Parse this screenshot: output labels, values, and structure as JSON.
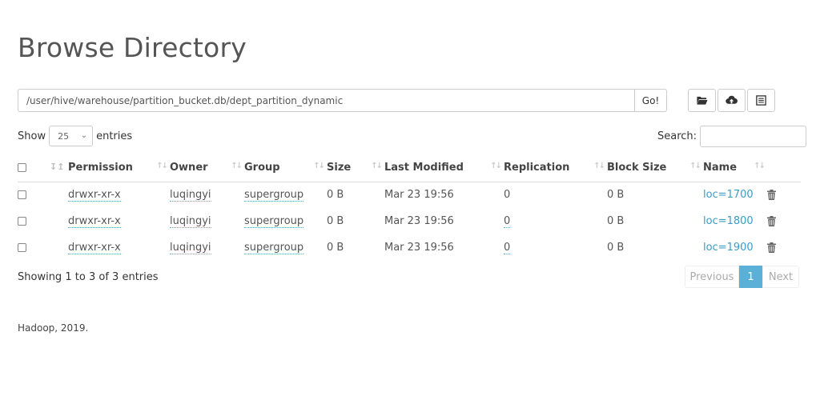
{
  "page": {
    "title": "Browse Directory"
  },
  "path_bar": {
    "value": "/user/hive/warehouse/partition_bucket.db/dept_partition_dynamic",
    "go_label": "Go!"
  },
  "toolbar": {
    "icons": [
      "folder-open-icon",
      "upload-icon",
      "list-icon"
    ]
  },
  "show": {
    "prefix": "Show",
    "selected": "25",
    "suffix": "entries"
  },
  "search": {
    "label": "Search:",
    "value": ""
  },
  "table": {
    "columns": [
      "Permission",
      "Owner",
      "Group",
      "Size",
      "Last Modified",
      "Replication",
      "Block Size",
      "Name"
    ],
    "rows": [
      {
        "permission": "drwxr-xr-x",
        "owner": "luqingyi",
        "group": "supergroup",
        "size": "0 B",
        "modified": "Mar 23 19:56",
        "replication": "0",
        "block_size": "0 B",
        "name": "loc=1700"
      },
      {
        "permission": "drwxr-xr-x",
        "owner": "luqingyi",
        "group": "supergroup",
        "size": "0 B",
        "modified": "Mar 23 19:56",
        "replication": "0",
        "block_size": "0 B",
        "name": "loc=1800"
      },
      {
        "permission": "drwxr-xr-x",
        "owner": "luqingyi",
        "group": "supergroup",
        "size": "0 B",
        "modified": "Mar 23 19:56",
        "replication": "0",
        "block_size": "0 B",
        "name": "loc=1900"
      }
    ]
  },
  "info": {
    "prefix": "Showing",
    "from": "1",
    "to_word": "to",
    "to": "3",
    "of_word": "of",
    "total": "3",
    "suffix": "entries"
  },
  "pagination": {
    "previous": "Previous",
    "current": "1",
    "next": "Next"
  },
  "footer": {
    "text": "Hadoop, 2019."
  },
  "colors": {
    "accent": "#5bb0d8",
    "link": "#3a9cc8"
  }
}
